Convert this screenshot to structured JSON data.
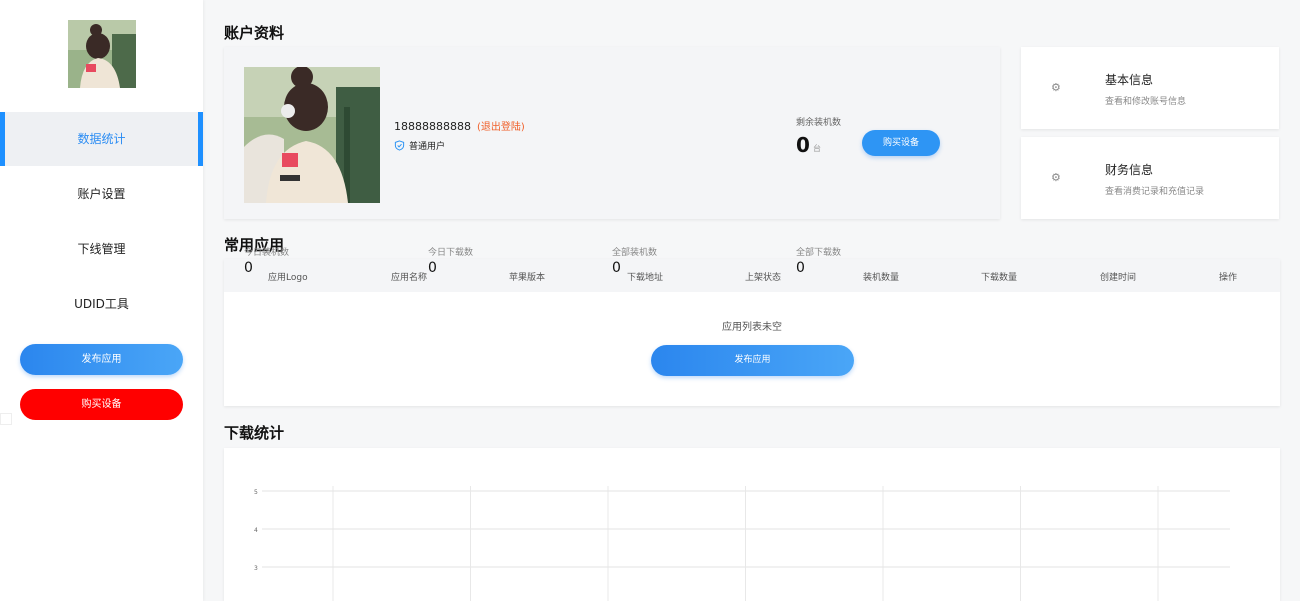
{
  "sidebar": {
    "menu": [
      {
        "label": "数据统计",
        "active": true
      },
      {
        "label": "账户设置",
        "active": false
      },
      {
        "label": "下线管理",
        "active": false
      },
      {
        "label": "UDID工具",
        "active": false
      }
    ],
    "publish_label": "发布应用",
    "buy_label": "购买设备"
  },
  "account": {
    "section_title": "账户资料",
    "phone": "18888888888",
    "logout_label": "(退出登陆)",
    "role": "普通用户",
    "remaining_label": "剩余装机数",
    "remaining_value": "0",
    "remaining_unit": "台",
    "buy_label": "购买设备"
  },
  "info_cards": [
    {
      "title": "基本信息",
      "subtitle": "查看和修改账号信息",
      "icon": "gear-icon"
    },
    {
      "title": "财务信息",
      "subtitle": "查看消费记录和充值记录",
      "icon": "gear-icon"
    }
  ],
  "apps": {
    "section_title": "常用应用",
    "stats": [
      {
        "label": "今日装机数",
        "value": "0"
      },
      {
        "label": "今日下载数",
        "value": "0"
      },
      {
        "label": "全部装机数",
        "value": "0"
      },
      {
        "label": "全部下载数",
        "value": "0"
      }
    ],
    "columns": [
      "应用Logo",
      "应用名称",
      "苹果版本",
      "下载地址",
      "上架状态",
      "装机数量",
      "下载数量",
      "创建时间",
      "操作"
    ],
    "empty_text": "应用列表未空",
    "publish_label": "发布应用"
  },
  "downloads": {
    "section_title": "下载统计"
  },
  "chart_data": {
    "type": "line",
    "y_ticks": [
      "5",
      "4",
      "3"
    ],
    "x_gridlines": 7,
    "grid": true
  },
  "colors": {
    "accent": "#2e95f4",
    "danger": "#ff0000",
    "logout": "#f0602a"
  }
}
